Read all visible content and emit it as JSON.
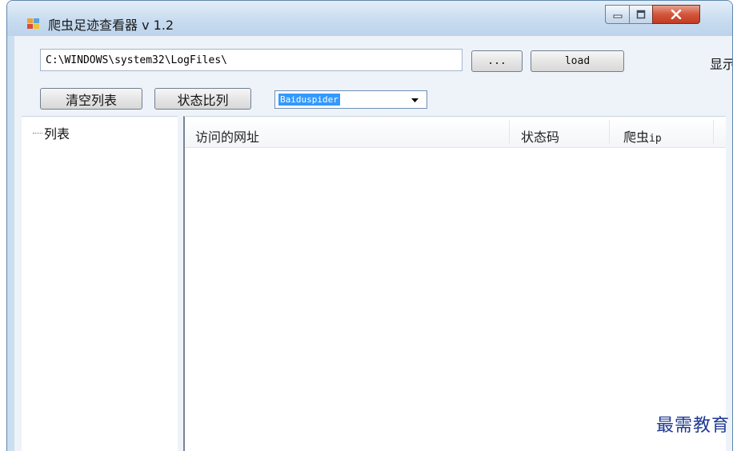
{
  "window": {
    "title": "爬虫足迹查看器 v 1.2",
    "buttons": {
      "minimize_icon": "minimize-icon",
      "maximize_icon": "maximize-icon",
      "close_icon": "close-icon"
    }
  },
  "toolbar": {
    "path_value": "C:\\WINDOWS\\system32\\LogFiles\\",
    "browse_label": "...",
    "load_label": "load",
    "show_label": "显示",
    "clear_list_label": "清空列表",
    "status_ratio_label": "状态比列",
    "spider_select": {
      "selected": "Baiduspider"
    }
  },
  "tree": {
    "root_label": "列表"
  },
  "listview": {
    "columns": [
      "访问的网址",
      "状态码",
      "爬虫"
    ],
    "ip_suffix": "ip",
    "rows": []
  },
  "watermark": "最需教育",
  "colors": {
    "title_bar": "#c8dcf0",
    "selection": "#3399ff",
    "close_button": "#d2553a",
    "watermark": "#1f3a93"
  }
}
